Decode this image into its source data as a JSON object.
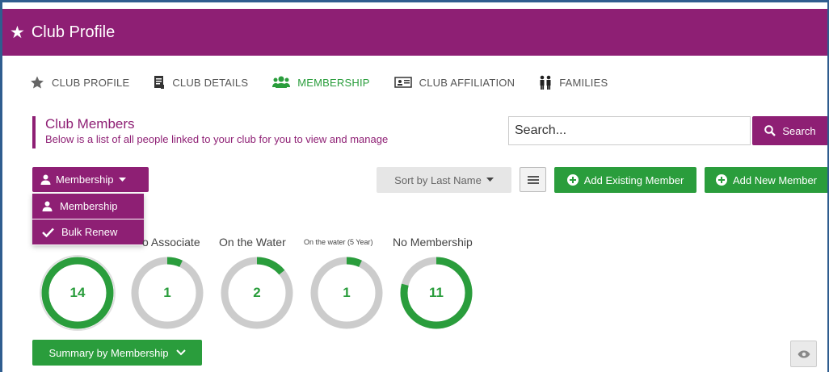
{
  "header": {
    "star_icon": "star-icon",
    "title": "Club Profile"
  },
  "tabs": [
    {
      "label": "CLUB PROFILE",
      "icon": "star-icon"
    },
    {
      "label": "CLUB DETAILS",
      "icon": "document-icon"
    },
    {
      "label": "MEMBERSHIP",
      "icon": "users-icon",
      "active": true
    },
    {
      "label": "CLUB AFFILIATION",
      "icon": "id-card-icon"
    },
    {
      "label": "FAMILIES",
      "icon": "family-icon"
    }
  ],
  "section": {
    "title": "Club Members",
    "subtitle": "Below is a list of all people linked to your club for you to view and manage"
  },
  "search": {
    "placeholder": "Search...",
    "button_label": "Search"
  },
  "membership_dropdown": {
    "label": "Membership",
    "menu": [
      {
        "label": "Membership",
        "icon": "user-icon"
      },
      {
        "label": "Bulk Renew",
        "icon": "check-icon"
      }
    ]
  },
  "toolbar": {
    "sort_label": "Sort by Last Name",
    "add_existing_label": "Add Existing Member",
    "add_new_label": "Add New Member"
  },
  "categories": [
    {
      "label": "",
      "value": "14",
      "fraction": 1.0
    },
    {
      "label": "o Associate",
      "value": "1",
      "fraction": 0.07
    },
    {
      "label": "On the Water",
      "value": "2",
      "fraction": 0.14
    },
    {
      "label": "On the water (5 Year)",
      "value": "1",
      "fraction": 0.07
    },
    {
      "label": "No Membership",
      "value": "11",
      "fraction": 0.79
    }
  ],
  "summary": {
    "label": "Summary by Membership"
  },
  "colors": {
    "brand": "#8e1f74",
    "accent": "#2a9d3c",
    "ring_track": "#cccccc",
    "frame": "#2f5d8f"
  }
}
